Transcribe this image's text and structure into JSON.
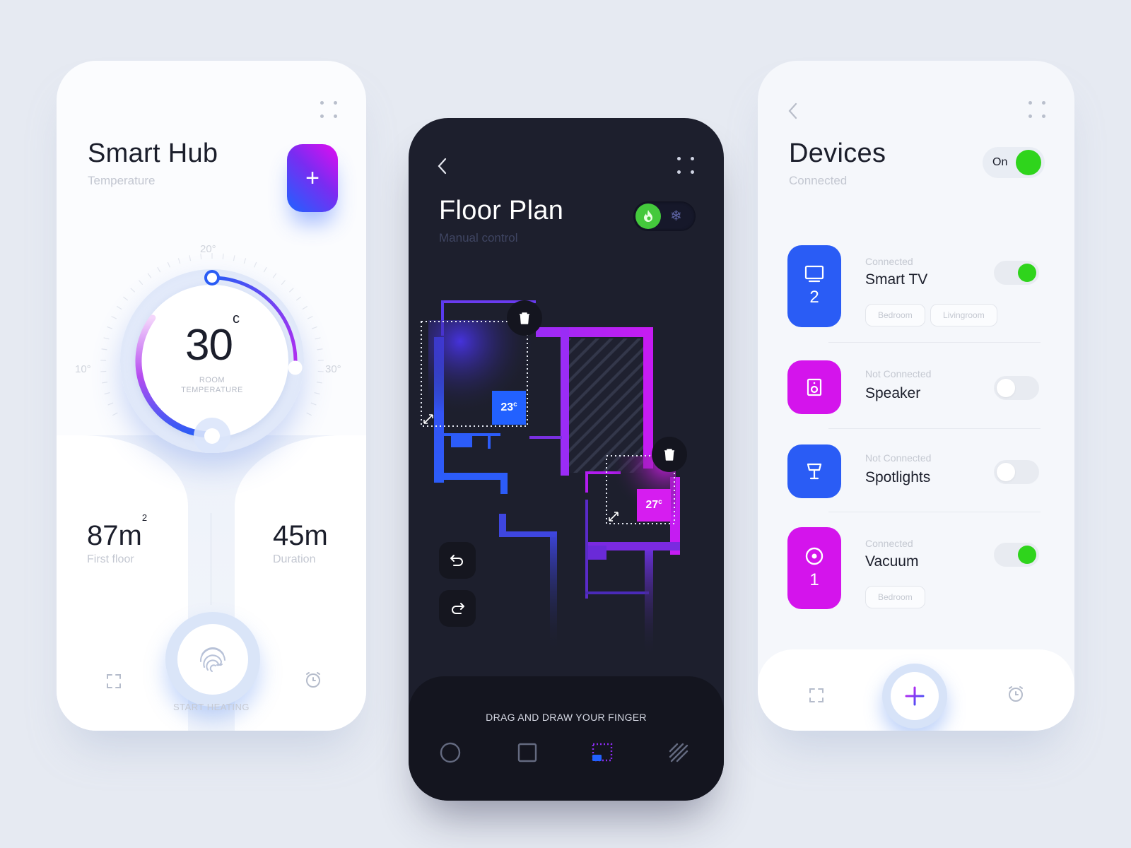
{
  "smart_hub": {
    "title": "Smart Hub",
    "subtitle": "Temperature",
    "add_button": "+",
    "dial": {
      "value": "30",
      "unit": "c",
      "label_line1": "ROOM",
      "label_line2": "TEMPERATURE",
      "scale_min_label": "10°",
      "scale_mid_label": "20°",
      "scale_max_label": "30°",
      "scale_min": 10,
      "scale_max": 30,
      "set_from": 20,
      "set_to": 30
    },
    "stats": [
      {
        "value": "87m",
        "sup": "2",
        "label": "First floor"
      },
      {
        "value": "45m",
        "sup": "",
        "label": "Duration"
      }
    ],
    "action_label": "START HEATING",
    "nav_icons": [
      "scan-frame-icon",
      "fingerprint-icon",
      "alarm-clock-icon"
    ]
  },
  "floor_plan": {
    "title": "Floor Plan",
    "subtitle": "Manual control",
    "mode_toggle": {
      "active": "heat",
      "options": [
        "heat",
        "cool"
      ]
    },
    "zones": [
      {
        "temp": "23",
        "unit": "c",
        "color": "#2261ff"
      },
      {
        "temp": "27",
        "unit": "c",
        "color": "#d61df0"
      }
    ],
    "hint": "DRAG AND DRAW YOUR FINGER",
    "tools": [
      {
        "name": "circle",
        "active": false
      },
      {
        "name": "square",
        "active": false
      },
      {
        "name": "selection",
        "active": true
      },
      {
        "name": "hatch",
        "active": false
      }
    ],
    "colors": {
      "bg": "#1d1f2d",
      "blue": "#2f5cff",
      "purple": "#9b2cf7",
      "magenta": "#d61df0",
      "heat_green": "#44c93c"
    }
  },
  "devices": {
    "title": "Devices",
    "subtitle": "Connected",
    "master_toggle": {
      "label": "On",
      "on": true
    },
    "items": [
      {
        "status": "Connected",
        "name": "Smart TV",
        "count": "2",
        "color": "#2a5cf5",
        "icon": "tv-icon",
        "on": true,
        "tags": [
          "Bedroom",
          "Livingroom"
        ]
      },
      {
        "status": "Not Connected",
        "name": "Speaker",
        "count": "",
        "color": "#d414ec",
        "icon": "speaker-icon",
        "on": false,
        "tags": []
      },
      {
        "status": "Not Connected",
        "name": "Spotlights",
        "count": "",
        "color": "#2a5cf5",
        "icon": "lamp-icon",
        "on": false,
        "tags": []
      },
      {
        "status": "Connected",
        "name": "Vacuum",
        "count": "1",
        "color": "#d414ec",
        "icon": "vacuum-icon",
        "on": true,
        "tags": [
          "Bedroom"
        ]
      }
    ],
    "bottom_add": "+"
  },
  "colors": {
    "background": "#e6eaf2",
    "toggle_on": "#2fd41c",
    "text_dark": "#1b1e2b",
    "text_muted": "#c3c7d1"
  }
}
